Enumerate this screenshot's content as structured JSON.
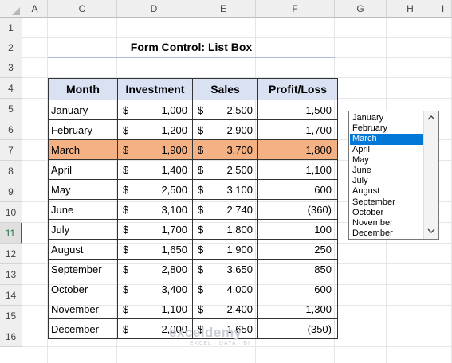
{
  "columns": [
    "A",
    "C",
    "D",
    "E",
    "F",
    "G",
    "H",
    "I"
  ],
  "rows": [
    "1",
    "2",
    "3",
    "4",
    "5",
    "6",
    "7",
    "8",
    "9",
    "10",
    "11",
    "12",
    "13",
    "14",
    "15",
    "16"
  ],
  "active_row": "11",
  "title": "Form Control: List Box",
  "table": {
    "headers": [
      "Month",
      "Investment",
      "Sales",
      "Profit/Loss"
    ],
    "currency": "$",
    "rows": [
      {
        "month": "January",
        "investment": "1,000",
        "sales": "2,500",
        "pl": "1,500"
      },
      {
        "month": "February",
        "investment": "1,200",
        "sales": "2,900",
        "pl": "1,700"
      },
      {
        "month": "March",
        "investment": "1,900",
        "sales": "3,700",
        "pl": "1,800",
        "highlight": true
      },
      {
        "month": "April",
        "investment": "1,400",
        "sales": "2,500",
        "pl": "1,100"
      },
      {
        "month": "May",
        "investment": "2,500",
        "sales": "3,100",
        "pl": "600"
      },
      {
        "month": "June",
        "investment": "3,100",
        "sales": "2,740",
        "pl": "(360)"
      },
      {
        "month": "July",
        "investment": "1,700",
        "sales": "1,800",
        "pl": "100"
      },
      {
        "month": "August",
        "investment": "1,650",
        "sales": "1,900",
        "pl": "250"
      },
      {
        "month": "September",
        "investment": "2,800",
        "sales": "3,650",
        "pl": "850"
      },
      {
        "month": "October",
        "investment": "3,400",
        "sales": "4,000",
        "pl": "600"
      },
      {
        "month": "November",
        "investment": "1,100",
        "sales": "2,400",
        "pl": "1,300"
      },
      {
        "month": "December",
        "investment": "2,000",
        "sales": "1,650",
        "pl": "(350)"
      }
    ]
  },
  "listbox": {
    "items": [
      "January",
      "February",
      "March",
      "April",
      "May",
      "June",
      "July",
      "August",
      "September",
      "October",
      "November",
      "December"
    ],
    "selected": "March",
    "scroll_up_icon": "chevron-up-icon",
    "scroll_down_icon": "chevron-down-icon"
  },
  "watermark": {
    "name": "exceldemy",
    "tagline": "EXCEL · DATA · BI"
  },
  "colors": {
    "header_fill": "#d9e1f2",
    "highlight_fill": "#f4b183",
    "selection": "#0078d7",
    "title_underline": "#a9bcd9"
  }
}
